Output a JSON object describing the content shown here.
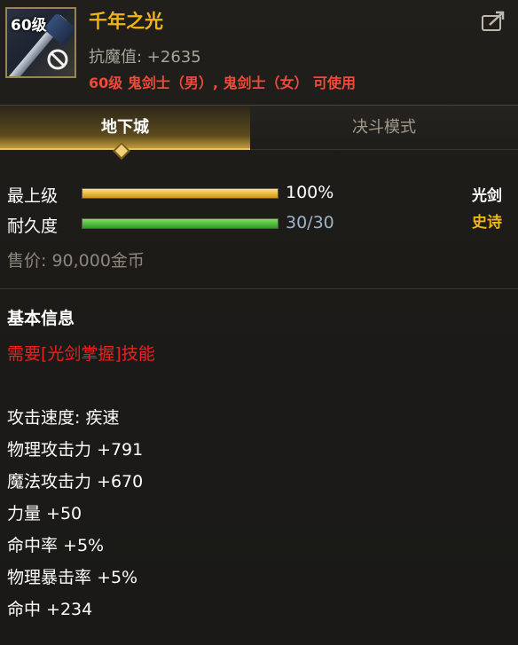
{
  "item": {
    "level_badge": "60级",
    "name": "千年之光",
    "magic_resist": "抗魔值: +2635",
    "usable_by": "60级 鬼剑士（男）, 鬼剑士（女） 可使用"
  },
  "tabs": [
    {
      "label": "地下城",
      "active": true
    },
    {
      "label": "决斗模式",
      "active": false
    }
  ],
  "stats": {
    "upgrade": {
      "label": "最上级",
      "value": "100%",
      "fill": 1.0
    },
    "durability": {
      "label": "耐久度",
      "value": "30/30",
      "fill": 1.0
    },
    "weapon_type": "光剑",
    "rarity": "史诗",
    "price": "售价: 90,000金币"
  },
  "basic_info": {
    "title": "基本信息",
    "requirement": "需要[光剑掌握]技能",
    "attributes": [
      "攻击速度: 疾速",
      "物理攻击力 +791",
      "魔法攻击力 +670",
      "力量 +50",
      "命中率 +5%",
      "物理暴击率 +5%",
      "命中 +234"
    ]
  },
  "colors": {
    "item_name": "#f0b419",
    "requirement_red": "#f21d1d",
    "usable_red": "#f04a3a",
    "upgrade_bar": "#e6b52a",
    "durability_bar": "#4cc23e"
  },
  "icons": {
    "restricted": "no-entry-icon",
    "export": "share-export-icon"
  }
}
